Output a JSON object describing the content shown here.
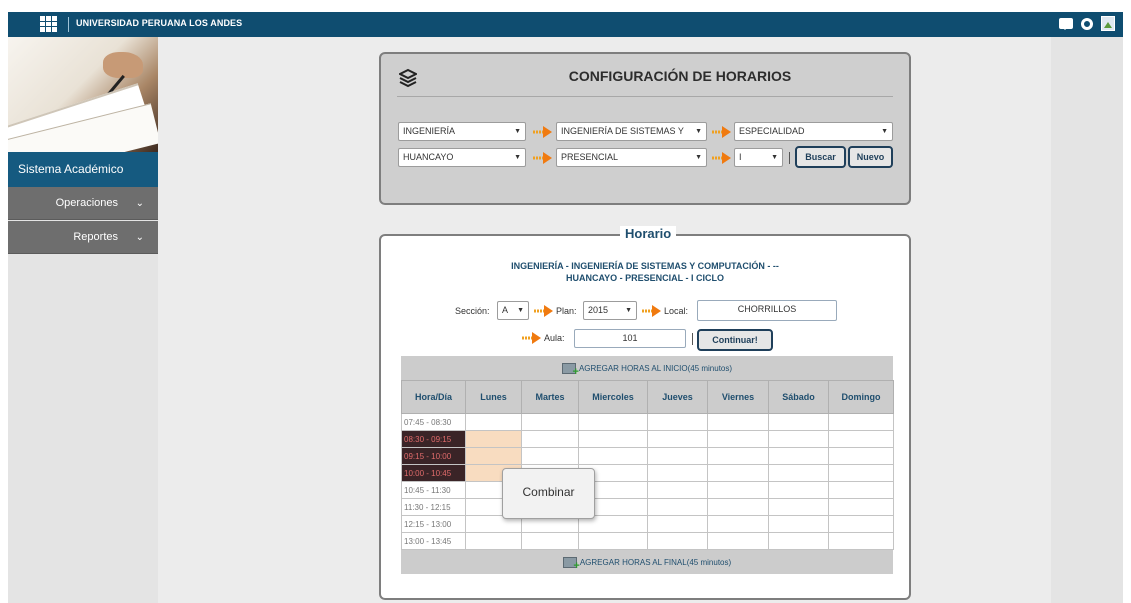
{
  "topbar": {
    "brand": "UNIVERSIDAD PERUANA LOS ANDES"
  },
  "sidebar": {
    "system_label": "Sistema Académico",
    "items": [
      {
        "label": "Operaciones",
        "chevron": "⌄"
      },
      {
        "label": "Reportes",
        "chevron": "⌄"
      }
    ]
  },
  "config": {
    "title": "CONFIGURACIÓN DE HORARIOS",
    "facultad": "INGENIERÍA",
    "carrera": "INGENIERÍA DE SISTEMAS Y",
    "especialidad": "ESPECIALIDAD",
    "sede": "HUANCAYO",
    "modalidad": "PRESENCIAL",
    "ciclo": "I",
    "buscar_label": "Buscar",
    "nuevo_label": "Nuevo",
    "caret": "▼"
  },
  "horario": {
    "legend": "Horario",
    "subtitle_line1": "INGENIERÍA - INGENIERÍA DE SISTEMAS Y COMPUTACIÓN - --",
    "subtitle_line2": "HUANCAYO - PRESENCIAL - I CICLO",
    "seccion_label": "Sección:",
    "seccion_value": "A",
    "plan_label": "Plan:",
    "plan_value": "2015",
    "local_label": "Local:",
    "local_value": "CHORRILLOS",
    "aula_label": "Aula:",
    "aula_value": "101",
    "continuar_label": "Continuar!",
    "add_start": "AGREGAR HORAS AL INICIO(45 minutos)",
    "add_end": "AGREGAR HORAS AL FINAL(45 minutos)",
    "columns": [
      "Hora/Día",
      "Lunes",
      "Martes",
      "Miercoles",
      "Jueves",
      "Viernes",
      "Sábado",
      "Domingo"
    ],
    "rows": [
      "07:45 - 08:30",
      "08:30 - 09:15",
      "09:15 - 10:00",
      "10:00 - 10:45",
      "10:45 - 11:30",
      "11:30 - 12:15",
      "12:15 - 13:00",
      "13:00 - 13:45"
    ],
    "selected_rows": [
      1,
      2,
      3
    ]
  },
  "context_menu": {
    "label": "Combinar"
  },
  "colors": {
    "topbar": "#0f4d70",
    "sidebar_active": "#155a80",
    "sidebar_item": "#6e6e6e",
    "selected_time": "#3a2427",
    "selected_cell": "#f8dcc0"
  }
}
